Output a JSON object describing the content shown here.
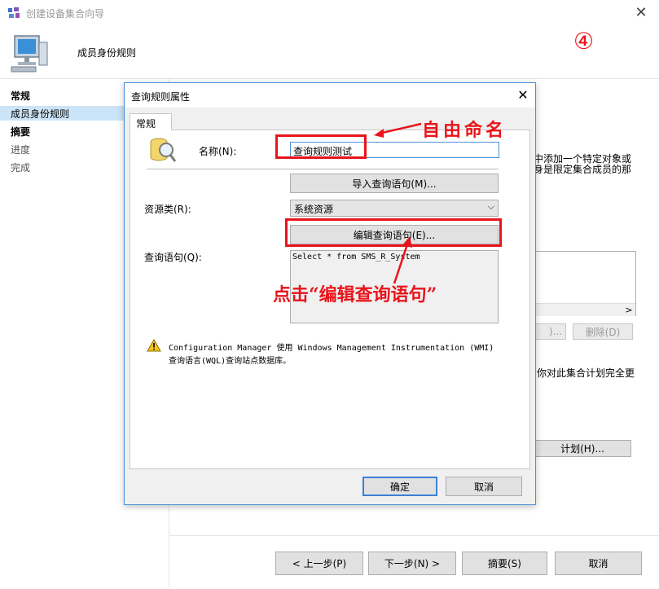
{
  "wizard": {
    "title": "创建设备集合向导",
    "header_title": "成员身份规则",
    "step_badge": "④",
    "nav": [
      "常规",
      "成员身份规则",
      "摘要",
      "进度",
      "完成"
    ],
    "bg_text_line1": "中添加一个特定对象或",
    "bg_text_line2": "身是限定集合成员的那",
    "bg_text_line3": "你对此集合计划完全更",
    "bg_delete_button": "删除(D)",
    "bg_schedule_button": "计划(H)...",
    "buttons": {
      "prev": "< 上一步(P)",
      "next": "下一步(N) >",
      "summary": "摘要(S)",
      "cancel": "取消"
    }
  },
  "dialog": {
    "title": "查询规则属性",
    "tab": "常规",
    "name_label": "名称(N):",
    "name_value": "查询规则测试",
    "import_button": "导入查询语句(M)...",
    "resource_label": "资源类(R):",
    "resource_value": "系统资源",
    "edit_button": "编辑查询语句(E)...",
    "query_label": "查询语句(Q):",
    "query_text": "Select * from SMS_R_System",
    "info_line1": "Configuration Manager 使用 Windows Management Instrumentation (WMI)",
    "info_line2": "查询语言(WQL)查询站点数据库。",
    "ok_button": "确定",
    "cancel_button": "取消"
  },
  "annotations": {
    "name_note": "自由命名",
    "edit_note": "点击“编辑查询语句”"
  }
}
